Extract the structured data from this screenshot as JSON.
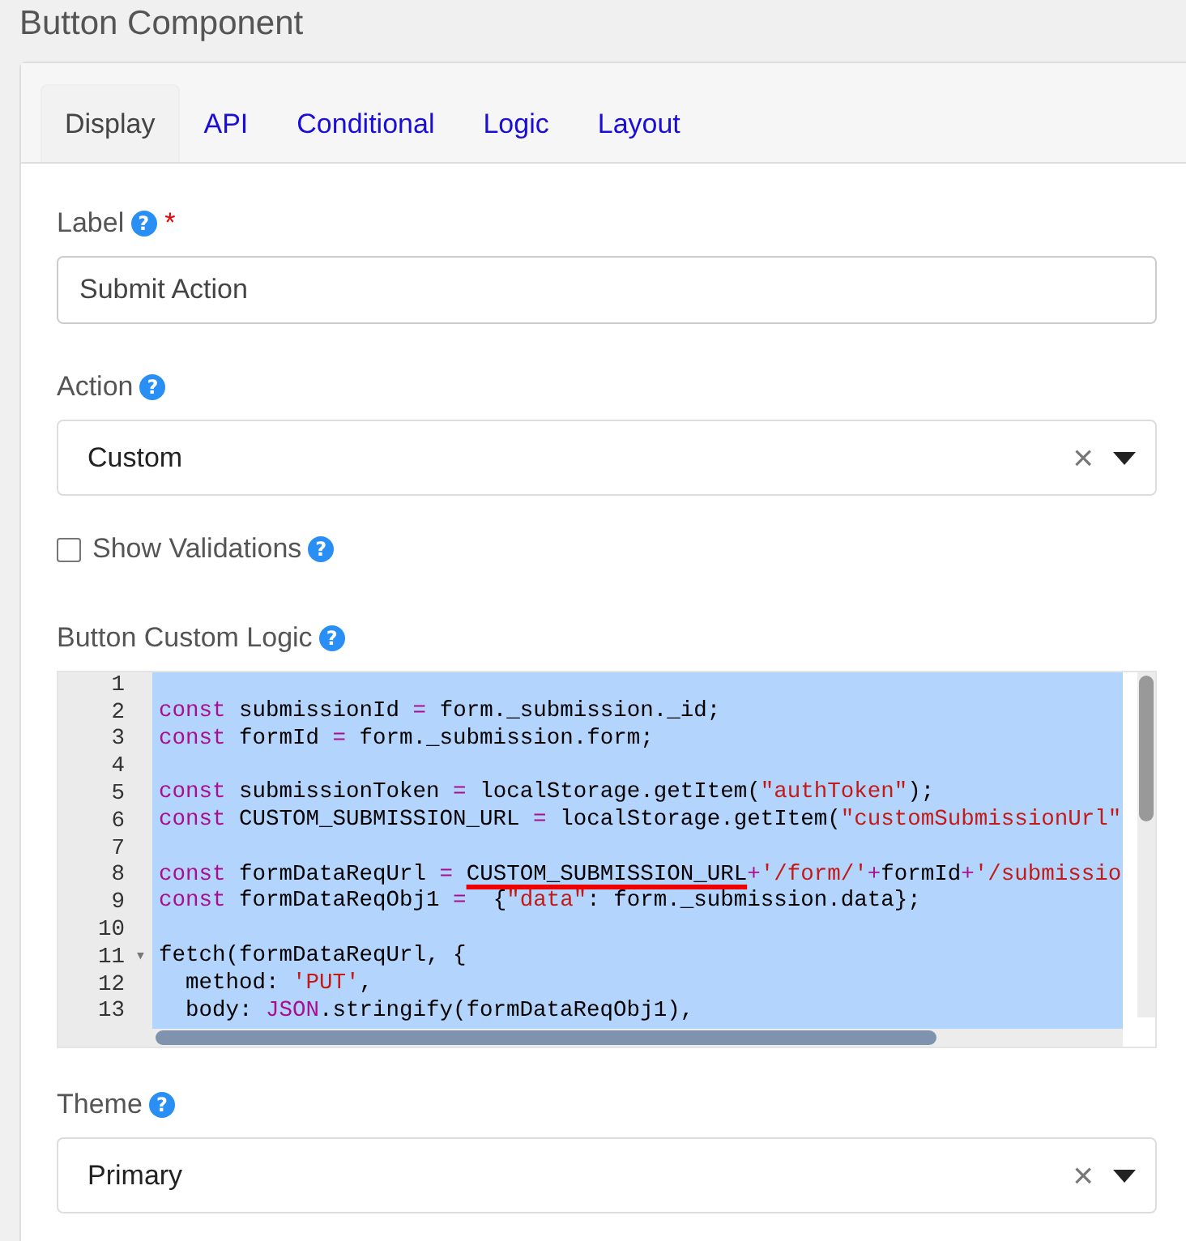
{
  "title": "Button Component",
  "tabs": [
    {
      "label": "Display",
      "selected": true
    },
    {
      "label": "API",
      "selected": false
    },
    {
      "label": "Conditional",
      "selected": false
    },
    {
      "label": "Logic",
      "selected": false
    },
    {
      "label": "Layout",
      "selected": false
    }
  ],
  "fields": [
    {
      "kind": "text",
      "label": "Label",
      "help": "?",
      "required_mark": "*",
      "value": "Submit Action"
    },
    {
      "kind": "select",
      "label": "Action",
      "help": "?",
      "value": "Custom",
      "clear": "×"
    },
    {
      "kind": "checkbox",
      "label": "Show Validations",
      "help": "?",
      "checked": false
    },
    {
      "kind": "code",
      "label": "Button Custom Logic",
      "help": "?",
      "lines": [
        {
          "number": "1"
        },
        {
          "number": "2",
          "tokens": [
            {
              "kind": "keyword",
              "text": "const"
            },
            {
              "kind": "plain",
              "text": " submissionId "
            },
            {
              "kind": "operator",
              "text": "="
            },
            {
              "kind": "plain",
              "text": " form._submission._id;"
            }
          ]
        },
        {
          "number": "3",
          "tokens": [
            {
              "kind": "keyword",
              "text": "const"
            },
            {
              "kind": "plain",
              "text": " formId "
            },
            {
              "kind": "operator",
              "text": "="
            },
            {
              "kind": "plain",
              "text": " form._submission.form;"
            }
          ]
        },
        {
          "number": "4"
        },
        {
          "number": "5",
          "tokens": [
            {
              "kind": "keyword",
              "text": "const"
            },
            {
              "kind": "plain",
              "text": " submissionToken "
            },
            {
              "kind": "operator",
              "text": "="
            },
            {
              "kind": "plain",
              "text": " localStorage.getItem("
            },
            {
              "kind": "string",
              "text": "\"authToken\""
            },
            {
              "kind": "plain",
              "text": ");"
            }
          ]
        },
        {
          "number": "6",
          "tokens": [
            {
              "kind": "keyword",
              "text": "const"
            },
            {
              "kind": "plain",
              "text": " CUSTOM_SUBMISSION_URL "
            },
            {
              "kind": "operator",
              "text": "="
            },
            {
              "kind": "plain",
              "text": " localStorage.getItem("
            },
            {
              "kind": "string",
              "text": "\"customSubmissionUrl\""
            }
          ]
        },
        {
          "number": "7"
        },
        {
          "number": "8",
          "tokens": [
            {
              "kind": "keyword",
              "text": "const"
            },
            {
              "kind": "plain",
              "text": " formDataReqUrl "
            },
            {
              "kind": "operator",
              "text": "= "
            },
            {
              "kind": "marked",
              "text": "CUSTOM_SUBMISSION_URL"
            },
            {
              "kind": "operator",
              "text": "+"
            },
            {
              "kind": "string",
              "text": "'/form/'"
            },
            {
              "kind": "operator",
              "text": "+"
            },
            {
              "kind": "plain",
              "text": "formId"
            },
            {
              "kind": "operator",
              "text": "+"
            },
            {
              "kind": "string",
              "text": "'/submissio"
            }
          ]
        },
        {
          "number": "9",
          "tokens": [
            {
              "kind": "keyword",
              "text": "const"
            },
            {
              "kind": "plain",
              "text": " formDataReqObj1 "
            },
            {
              "kind": "operator",
              "text": "="
            },
            {
              "kind": "plain",
              "text": "  {"
            },
            {
              "kind": "string",
              "text": "\"data\""
            },
            {
              "kind": "plain",
              "text": ": form._submission.data};"
            }
          ]
        },
        {
          "number": "10"
        },
        {
          "number": "11",
          "fold_marker": "▾",
          "tokens": [
            {
              "kind": "plain",
              "text": "fetch(formDataReqUrl, {"
            }
          ]
        },
        {
          "number": "12",
          "tokens": [
            {
              "kind": "plain",
              "text": "  method: "
            },
            {
              "kind": "string",
              "text": "'PUT'"
            },
            {
              "kind": "plain",
              "text": ","
            }
          ]
        },
        {
          "number": "13",
          "tokens": [
            {
              "kind": "plain",
              "text": "  body: "
            },
            {
              "kind": "keyword",
              "text": "JSON"
            },
            {
              "kind": "plain",
              "text": ".stringify(formDataReqObj1),"
            }
          ]
        }
      ]
    },
    {
      "kind": "select",
      "label": "Theme",
      "help": "?",
      "value": "Primary",
      "clear": "×"
    }
  ]
}
